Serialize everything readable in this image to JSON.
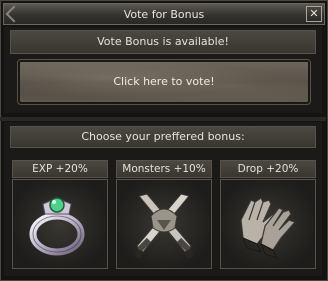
{
  "window": {
    "title": "Vote for Bonus",
    "close_symbol": "✕"
  },
  "status": {
    "text": "Vote Bonus is available!"
  },
  "vote": {
    "label": "Click here to vote!"
  },
  "choose": {
    "text": "Choose your preffered bonus:"
  },
  "bonuses": [
    {
      "label": "EXP +20%",
      "icon": "ring-icon"
    },
    {
      "label": "Monsters +10%",
      "icon": "crossed-swords-icon"
    },
    {
      "label": "Drop +20%",
      "icon": "gloves-icon"
    }
  ],
  "colors": {
    "accent_gem": "#4fd08a",
    "ring_silver": "#d8d4e0",
    "sword_steel": "#c8c4bc"
  }
}
